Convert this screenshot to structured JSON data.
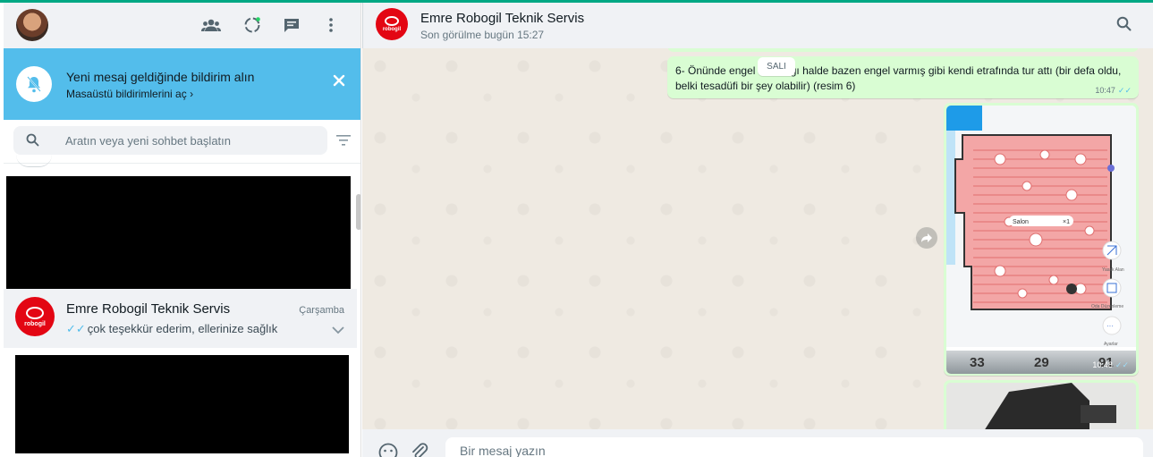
{
  "colors": {
    "accent": "#00a884",
    "notification_bg": "#53bdeb",
    "outgoing_bubble": "#d9fdd3",
    "brand_red": "#e30613",
    "read_ticks": "#53bdeb"
  },
  "left_header": {
    "icons": [
      "communities-icon",
      "status-icon",
      "new-chat-icon",
      "menu-icon"
    ]
  },
  "notification": {
    "title": "Yeni mesaj geldiğinde bildirim alın",
    "link": "Masaüstü bildirimlerini aç",
    "link_chevron": "›"
  },
  "search": {
    "placeholder": "Aratın veya yeni sohbet başlatın"
  },
  "chat_list": {
    "items": [
      {
        "name": "Emre Robogil Teknik Servis",
        "date": "Çarşamba",
        "ticks": "✓✓",
        "last_message": "çok teşekkür ederim, ellerinize sağlık",
        "avatar_text": "robogil"
      }
    ]
  },
  "conversation": {
    "contact_name": "Emre Robogil Teknik Servis",
    "contact_status": "Son görülme bugün 15:27",
    "avatar_text": "robogil",
    "date_chip": "SALI",
    "messages": [
      {
        "text": "6-     Önünde engel olmadığı halde bazen engel varmış gibi kendi etrafında tur attı (bir defa oldu, belki tesadüfi bir şey olabilir) (resim 6)",
        "time": "10:47",
        "ticks": "✓✓"
      },
      {
        "type": "image",
        "time": "10:48",
        "ticks": "✓✓",
        "map_labels": {
          "room": "Salon",
          "count": "×1",
          "side_1": "Yasak Alan",
          "side_2": "Oda Düzenleme",
          "side_3": "Ayarlar"
        },
        "stats": [
          "33",
          "29",
          "91"
        ]
      }
    ]
  },
  "composer": {
    "placeholder": "Bir mesaj yazın"
  }
}
